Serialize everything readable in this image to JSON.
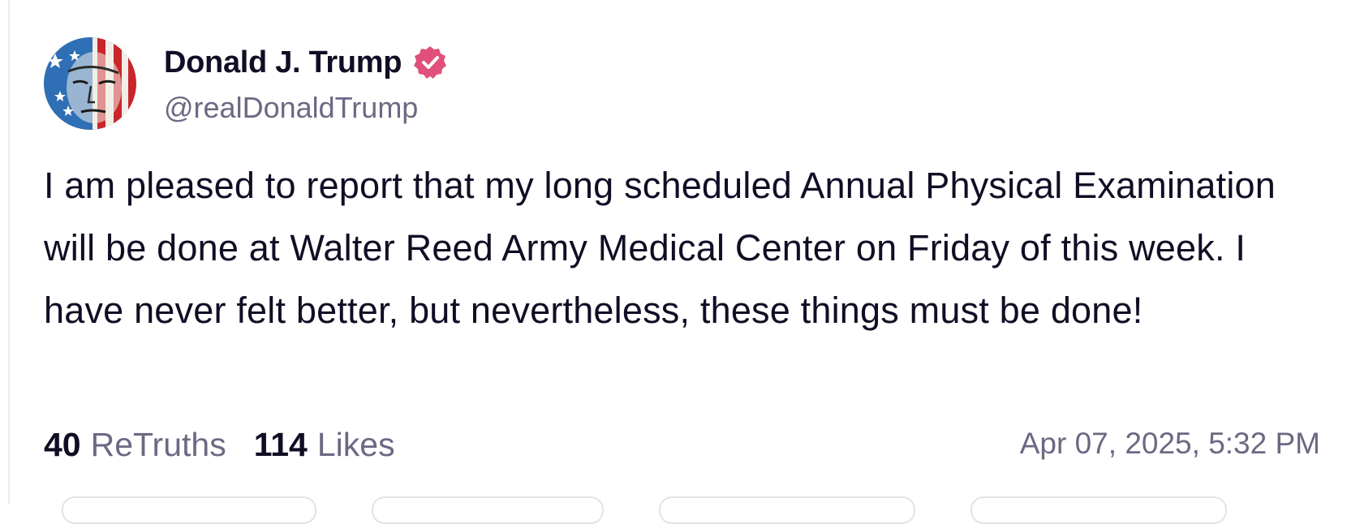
{
  "author": {
    "display_name": "Donald J. Trump",
    "handle": "@realDonaldTrump",
    "verified": true,
    "avatar_icon": "avatar-flag-portrait",
    "verified_icon": "verified-badge-icon",
    "verified_color": "#e0507a"
  },
  "post": {
    "text": "I am pleased to report that my long scheduled Annual Physical Examination will be done at Walter Reed Army Medical Center on Friday of this week. I have never felt better, but nevertheless, these things must be done!"
  },
  "stats": {
    "retruths_count": "40",
    "retruths_label": "ReTruths",
    "likes_count": "114",
    "likes_label": "Likes"
  },
  "timestamp": "Apr 07, 2025, 5:32 PM",
  "colors": {
    "text_primary": "#0f0e24",
    "text_secondary": "#6b6982",
    "border": "#e3e3ea"
  }
}
